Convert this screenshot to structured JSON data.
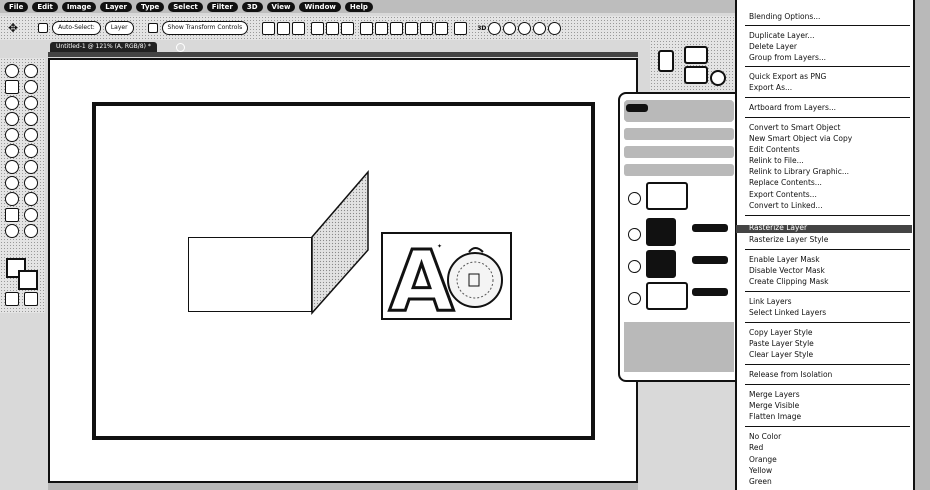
{
  "menubar": {
    "items": [
      "File",
      "Edit",
      "Image",
      "Layer",
      "Type",
      "Select",
      "Filter",
      "3D",
      "View",
      "Window",
      "Help"
    ]
  },
  "options_bar": {
    "auto_select": "Auto-Select:",
    "layer": "Layer",
    "show_transform": "Show Transform Controls"
  },
  "document": {
    "tab_title": "Untitled-1 @ 121% (A, RGB/8) *"
  },
  "image_layer": {
    "letter": "A"
  },
  "context_menu": {
    "groups": [
      [
        "Blending Options..."
      ],
      [
        "Duplicate Layer...",
        "Delete Layer",
        "Group from Layers..."
      ],
      [
        "Quick Export as PNG",
        "Export As..."
      ],
      [
        "Artboard from Layers..."
      ],
      [
        "Convert to Smart Object",
        "New Smart Object via Copy",
        "Edit Contents",
        "Relink to File...",
        "Relink to Library Graphic...",
        "Replace Contents...",
        "Export Contents...",
        "Convert to Linked..."
      ],
      [
        "Rasterize Layer",
        "Rasterize Layer Style"
      ],
      [
        "Enable Layer Mask",
        "Disable Vector Mask",
        "Create Clipping Mask"
      ],
      [
        "Link Layers",
        "Select Linked Layers"
      ],
      [
        "Copy Layer Style",
        "Paste Layer Style",
        "Clear Layer Style"
      ],
      [
        "Release from Isolation"
      ],
      [
        "Merge Layers",
        "Merge Visible",
        "Flatten Image"
      ],
      [
        "No Color",
        "Red",
        "Orange",
        "Yellow",
        "Green"
      ]
    ]
  }
}
